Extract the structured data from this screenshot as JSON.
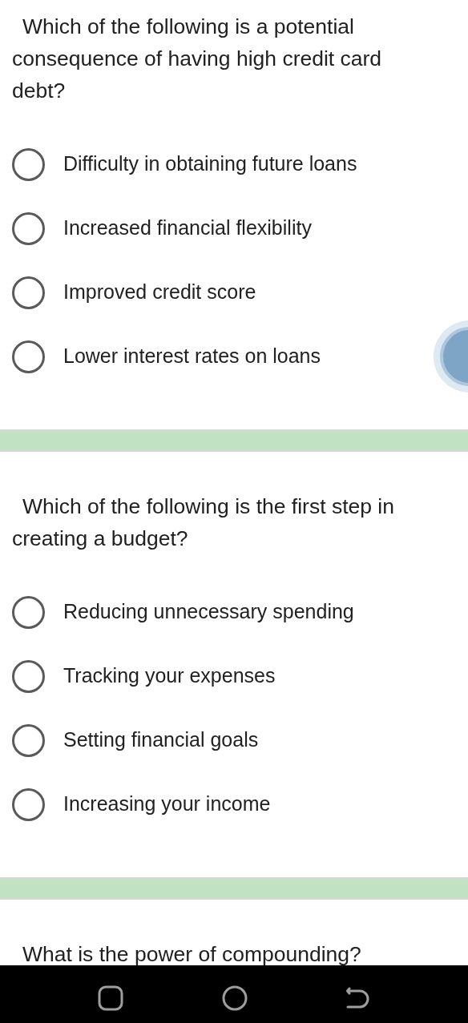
{
  "questions": [
    {
      "text": "Which of the following is a potential consequence of having high credit card debt?",
      "options": [
        {
          "label": "Difficulty in obtaining future loans",
          "selected": false
        },
        {
          "label": "Increased financial flexibility",
          "selected": false
        },
        {
          "label": "Improved credit score",
          "selected": false
        },
        {
          "label": "Lower interest rates on loans",
          "selected": false
        }
      ]
    },
    {
      "text": "Which of the following is the first step in creating a budget?",
      "options": [
        {
          "label": "Reducing unnecessary spending",
          "selected": false
        },
        {
          "label": "Tracking your expenses",
          "selected": false
        },
        {
          "label": "Setting financial goals",
          "selected": false
        },
        {
          "label": "Increasing your income",
          "selected": false
        }
      ]
    },
    {
      "text": "What is the power of compounding?"
    }
  ]
}
